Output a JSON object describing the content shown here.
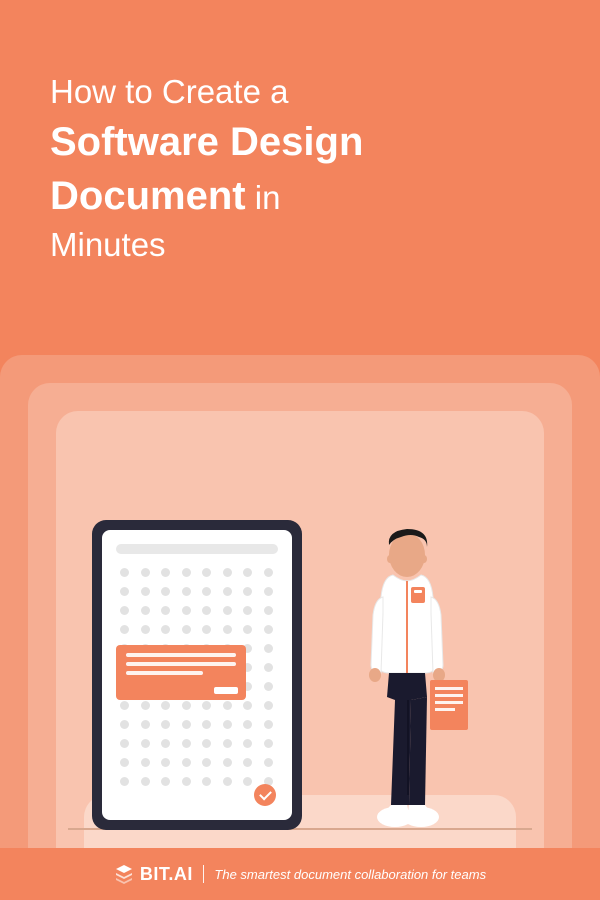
{
  "title": {
    "line1": "How to Create a",
    "line2": "Software Design",
    "line3_bold": "Document",
    "line3_rest": " in",
    "line4": "Minutes"
  },
  "footer": {
    "brand": "BIT.AI",
    "tagline": "The smartest document collaboration for teams"
  }
}
